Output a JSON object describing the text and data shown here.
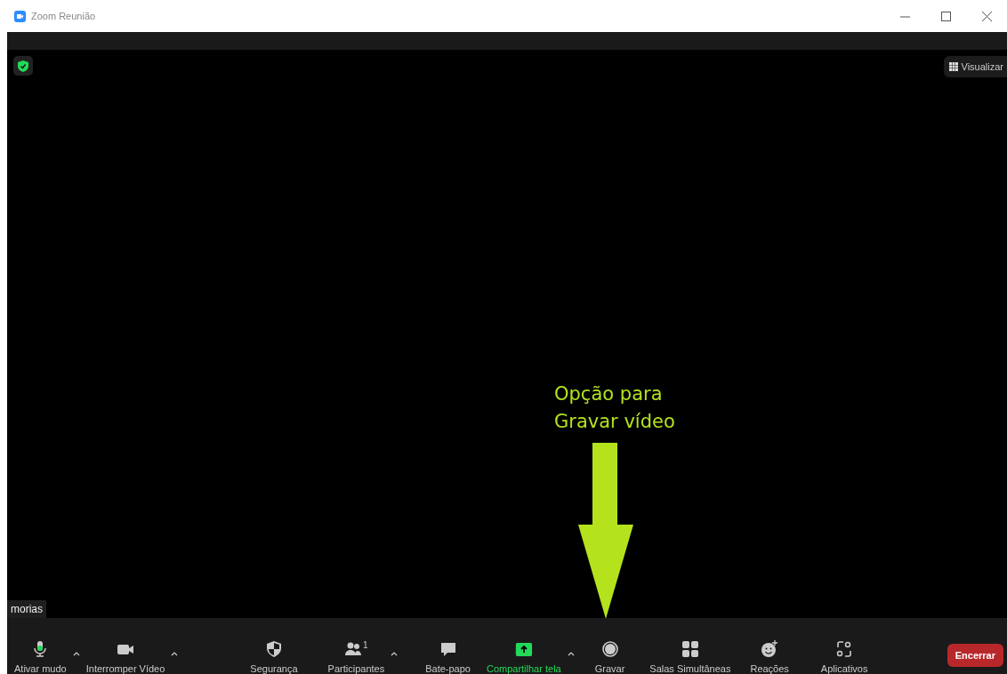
{
  "window": {
    "title": "Zoom Reunião"
  },
  "top_bar": {
    "view_button": "Visualizar"
  },
  "participant_name": "morias",
  "annotation": {
    "text": "Opção para\nGravar vídeo"
  },
  "toolbar": {
    "items": [
      {
        "kind": "mic",
        "label": "Ativar mudo",
        "caret": true,
        "highlighted": false
      },
      {
        "kind": "video",
        "label": "Interromper Vídeo",
        "caret": true,
        "highlighted": false
      },
      {
        "kind": "shield",
        "label": "Segurança",
        "caret": false,
        "highlighted": false
      },
      {
        "kind": "participants",
        "label": "Participantes",
        "count": "1",
        "caret": true,
        "highlighted": false
      },
      {
        "kind": "chat",
        "label": "Bate-papo",
        "caret": false,
        "highlighted": false
      },
      {
        "kind": "share",
        "label": "Compartilhar tela",
        "caret": true,
        "highlighted": true
      },
      {
        "kind": "record",
        "label": "Gravar",
        "caret": false,
        "highlighted": false
      },
      {
        "kind": "rooms",
        "label": "Salas Simultâneas",
        "caret": false,
        "highlighted": false
      },
      {
        "kind": "reactions",
        "label": "Reações",
        "caret": false,
        "highlighted": false
      },
      {
        "kind": "apps",
        "label": "Aplicativos",
        "caret": false,
        "highlighted": false
      }
    ],
    "end_button": "Encerrar"
  }
}
